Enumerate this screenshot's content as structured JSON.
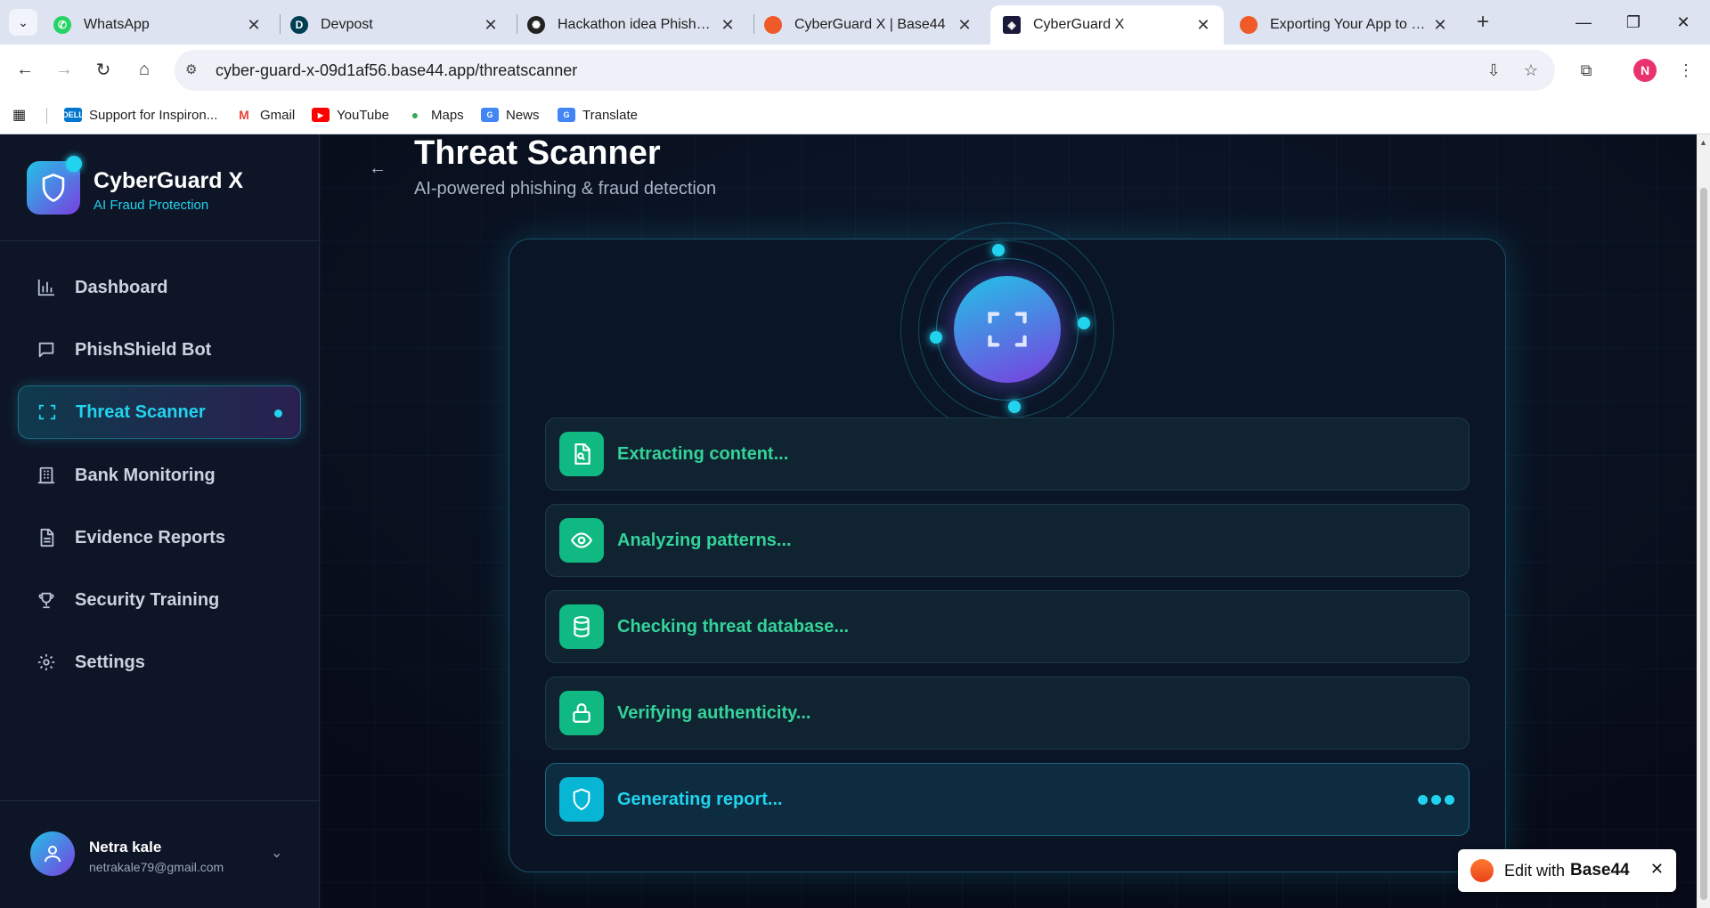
{
  "browser": {
    "tabs": [
      {
        "title": "WhatsApp",
        "favicon": "whatsapp-icon",
        "color": "#25d366"
      },
      {
        "title": "Devpost",
        "favicon": "devpost-icon",
        "color": "#003e54"
      },
      {
        "title": "Hackathon idea PhishGuard",
        "favicon": "openai-icon",
        "color": "#222222"
      },
      {
        "title": "CyberGuard X | Base44",
        "favicon": "base44-icon",
        "color": "#f05a28"
      },
      {
        "title": "CyberGuard X",
        "favicon": "cyberguard-icon",
        "color": "#1a1a3a"
      },
      {
        "title": "Exporting Your App to GitHub",
        "favicon": "base44-icon",
        "color": "#f05a28"
      }
    ],
    "active_tab": 4,
    "url": "cyber-guard-x-09d1af56.base44.app/threatscanner",
    "profile_initial": "N",
    "bookmarks": [
      {
        "label": "Support for Inspiron...",
        "icon": "dell-icon",
        "icon_text": "DELL",
        "color": "#0076ce"
      },
      {
        "label": "Gmail",
        "icon": "gmail-icon",
        "icon_text": "M",
        "color": "#ea4335"
      },
      {
        "label": "YouTube",
        "icon": "youtube-icon",
        "icon_text": "▶",
        "color": "#ff0000"
      },
      {
        "label": "Maps",
        "icon": "maps-icon",
        "icon_text": "●",
        "color": "#34a853"
      },
      {
        "label": "News",
        "icon": "news-icon",
        "icon_text": "G",
        "color": "#4285f4"
      },
      {
        "label": "Translate",
        "icon": "translate-icon",
        "icon_text": "G",
        "color": "#4285f4"
      }
    ]
  },
  "sidebar": {
    "brand_name": "CyberGuard X",
    "brand_sub": "AI Fraud Protection",
    "items": [
      {
        "label": "Dashboard",
        "icon": "bar-chart-icon"
      },
      {
        "label": "PhishShield Bot",
        "icon": "chat-icon"
      },
      {
        "label": "Threat Scanner",
        "icon": "scan-icon",
        "active": true
      },
      {
        "label": "Bank Monitoring",
        "icon": "bank-icon"
      },
      {
        "label": "Evidence Reports",
        "icon": "document-icon"
      },
      {
        "label": "Security Training",
        "icon": "trophy-icon"
      },
      {
        "label": "Settings",
        "icon": "gear-icon"
      }
    ],
    "user": {
      "name": "Netra kale",
      "email": "netrakale79@gmail.com"
    }
  },
  "main": {
    "title": "Threat Scanner",
    "subtitle": "AI-powered phishing & fraud detection",
    "steps": [
      {
        "label": "Extracting content...",
        "icon": "file-scan-icon",
        "status": "done"
      },
      {
        "label": "Analyzing patterns...",
        "icon": "eye-icon",
        "status": "done"
      },
      {
        "label": "Checking threat database...",
        "icon": "database-icon",
        "status": "done"
      },
      {
        "label": "Verifying authenticity...",
        "icon": "lock-icon",
        "status": "done"
      },
      {
        "label": "Generating report...",
        "icon": "shield-icon",
        "status": "in-progress"
      }
    ]
  },
  "edit_badge": {
    "label": "Edit with",
    "brand": "Base44"
  },
  "colors": {
    "accent": "#22d3ee",
    "success": "#10b981",
    "purple": "#7a3ee0"
  }
}
